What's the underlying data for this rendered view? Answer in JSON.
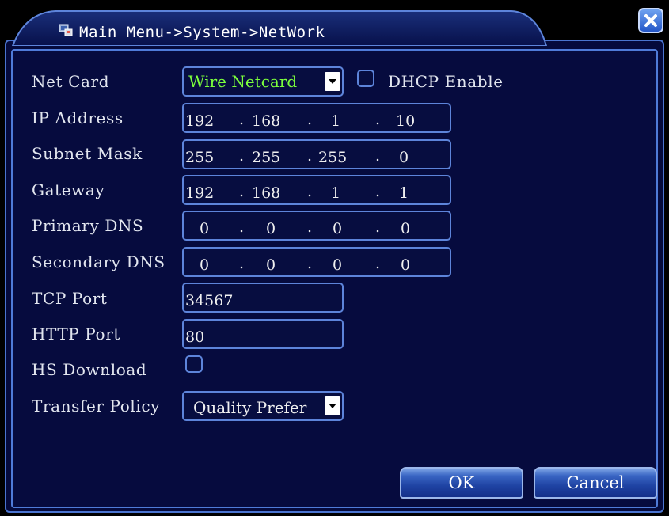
{
  "window": {
    "title": "Main Menu->System->NetWork"
  },
  "fields": {
    "net_card": {
      "label": "Net Card",
      "value": "Wire Netcard"
    },
    "dhcp": {
      "label": "DHCP Enable"
    },
    "ip_address": {
      "label": "IP Address",
      "octets": [
        "192",
        "168",
        "1",
        "10"
      ]
    },
    "subnet_mask": {
      "label": "Subnet Mask",
      "octets": [
        "255",
        "255",
        "255",
        "0"
      ]
    },
    "gateway": {
      "label": "Gateway",
      "octets": [
        "192",
        "168",
        "1",
        "1"
      ]
    },
    "primary_dns": {
      "label": "Primary DNS",
      "octets": [
        "0",
        "0",
        "0",
        "0"
      ]
    },
    "secondary_dns": {
      "label": "Secondary DNS",
      "octets": [
        "0",
        "0",
        "0",
        "0"
      ]
    },
    "tcp_port": {
      "label": "TCP Port",
      "value": "34567"
    },
    "http_port": {
      "label": "HTTP Port",
      "value": "80"
    },
    "hs_download": {
      "label": "HS Download"
    },
    "transfer_policy": {
      "label": "Transfer Policy",
      "value": "Quality Prefer"
    }
  },
  "buttons": {
    "ok": "OK",
    "cancel": "Cancel"
  },
  "colors": {
    "background": "#060b3e",
    "border": "#5d84da",
    "netcard_text": "#7cff3c"
  },
  "icons": {
    "title": "network-icon",
    "close": "close-icon",
    "dropdown": "dropdown-arrow-icon"
  }
}
